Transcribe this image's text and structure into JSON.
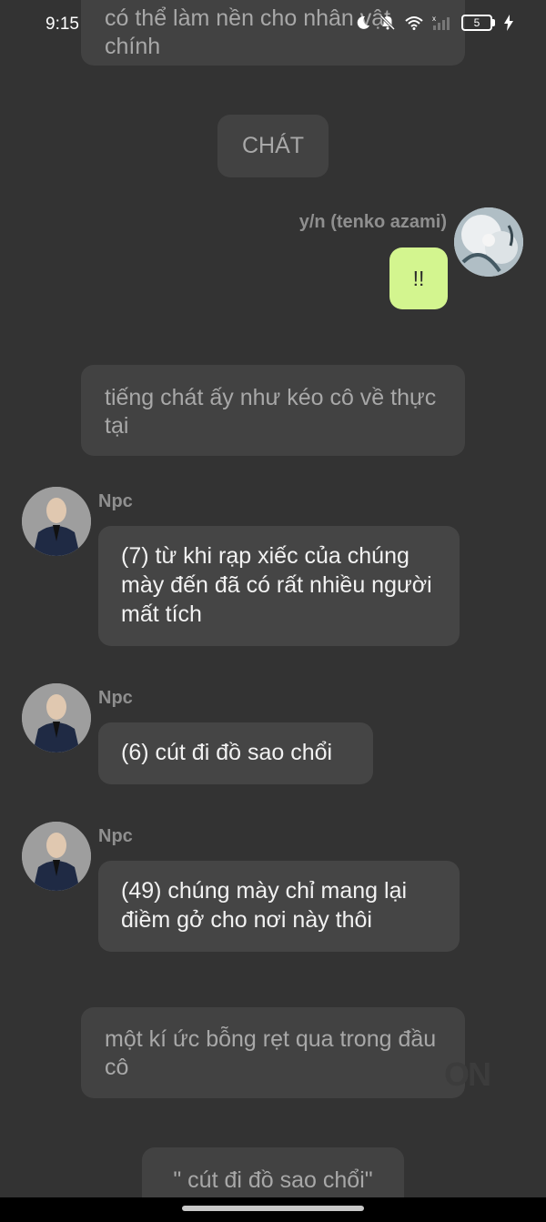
{
  "status_bar": {
    "time": "9:15",
    "battery": "5"
  },
  "messages": {
    "top_narration": "có thể làm nền cho nhân vật chính",
    "chat_sound": "CHÁT",
    "user_name": "y/n (tenko azami)",
    "user_message": "!!",
    "narration_1": "tiếng chát ấy như kéo cô về thực tại",
    "npc_1_name": "Npc",
    "npc_1_text": "(7) từ khi rạp xiếc của chúng mày đến đã có rất nhiều người mất tích",
    "npc_2_name": "Npc",
    "npc_2_text": "(6) cút đi đồ sao chổi",
    "npc_3_name": "Npc",
    "npc_3_text": "(49) chúng mày chỉ mang lại điềm gở cho nơi này thôi",
    "narration_2": "một kí ức bỗng rẹt qua trong đầu cô",
    "quote": "\" cút đi đồ sao chổi\""
  },
  "watermark": "ON",
  "colors": {
    "background": "#333333",
    "bubble": "#424242",
    "user_bubble": "#d3f58f"
  }
}
